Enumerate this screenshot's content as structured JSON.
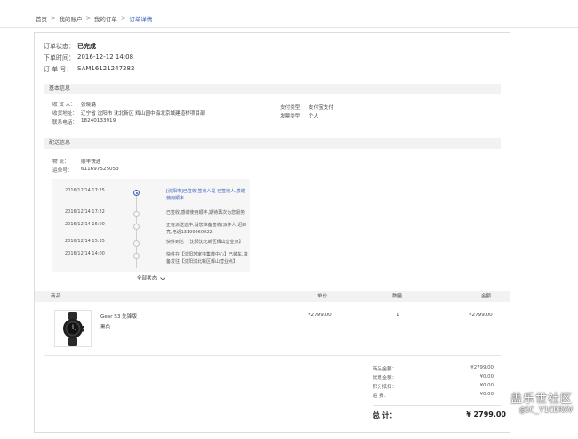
{
  "breadcrumb": {
    "home": "首页",
    "account": "我的账户",
    "orders": "我的订单",
    "current": "订单详情",
    "sep": ">"
  },
  "order": {
    "status_label": "订单状态：",
    "status": "已完成",
    "time_label": "下单时间：",
    "time": "2016-12-12 14:08",
    "number_label": "订 单 号：",
    "number": "SAM16121247282"
  },
  "basic_info": {
    "title": "基本信息",
    "receiver_label": "收 货 人：",
    "receiver": "张晓璐",
    "address_label": "收货地址：",
    "address": "辽宁省  沈阳市  沈北新区  辉山园中海北京城建道桥项目部",
    "phone_label": "联系电话：",
    "phone": "18240133919",
    "payment_label": "支付类型：",
    "payment": "支付宝支付",
    "invoice_label": "发票类型：",
    "invoice": "个人"
  },
  "shipping_info": {
    "title": "配送信息",
    "carrier_label": "物    流：",
    "carrier": "顺丰快递",
    "tracking_label": "运单号：",
    "tracking": "611697525053"
  },
  "tracking_events": [
    {
      "time": "2016/12/14 17:25",
      "desc": "[沈阳市]已签收,签收人是 已签收人,感谢使用顺丰",
      "active": true
    },
    {
      "time": "2016/12/14 17:22",
      "desc": "已签收,感谢使用顺丰,期待再次为您服务",
      "active": false
    },
    {
      "time": "2016/12/14 16:00",
      "desc": "正在派送途中,请您准备签收(派件人:迟峰亮,电话13190060022)",
      "active": false
    },
    {
      "time": "2016/12/14 15:35",
      "desc": "快件到达 【沈阳沈北新区辉山营业点】",
      "active": false
    },
    {
      "time": "2016/12/14 14:00",
      "desc": "快件在【沈阳苏家屯集散中心】已装车,准备发往【沈阳沈北新区辉山营业点】",
      "active": false
    }
  ],
  "tracking_more": "全部状态",
  "table": {
    "headers": {
      "product": "商品",
      "price": "单价",
      "qty": "数量",
      "amount": "金额"
    },
    "item": {
      "name": "Gear S3 先锋版",
      "color": "黑色",
      "price": "¥2799.00",
      "qty": "1",
      "amount": "¥2799.00"
    }
  },
  "summary": {
    "goods_label": "商品金额：",
    "goods": "¥2799.00",
    "discount_label": "优惠金额：",
    "discount": "¥0.00",
    "points_label": "积分抵扣：",
    "points": "¥0.00",
    "shipping_label": "运    费：",
    "shipping": "¥0.00",
    "total_label": "总    计：",
    "total": "¥ 2799.00"
  },
  "watermark": {
    "line1": "盖乐世社区",
    "line2": "@GC_Y1CDRXV"
  },
  "colors": {
    "accent": "#3a62b8",
    "price": "#d3771b",
    "section_bg": "#f2f2f2",
    "border": "#dcdcdc"
  }
}
